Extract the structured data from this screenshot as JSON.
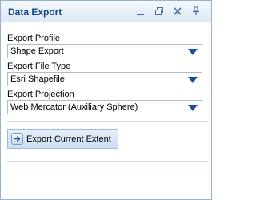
{
  "panel": {
    "title": "Data Export"
  },
  "titlebar_buttons": {
    "minimize_icon": "minimize-icon",
    "restore_icon": "restore-icon",
    "close_icon": "close-icon",
    "pin_icon": "pin-icon"
  },
  "fields": [
    {
      "label": "Export Profile",
      "value": "Shape Export"
    },
    {
      "label": "Export File Type",
      "value": "Esri Shapefile"
    },
    {
      "label": "Export Projection",
      "value": "Web Mercator (Auxiliary Sphere)"
    }
  ],
  "export_button": {
    "label": "Export Current Extent",
    "icon": "export-arrow-icon"
  },
  "colors": {
    "title_text": "#15428b",
    "dropdown_arrow": "#1f4d96",
    "divider": "#c9dcd6",
    "button_border": "#99bbe8"
  }
}
